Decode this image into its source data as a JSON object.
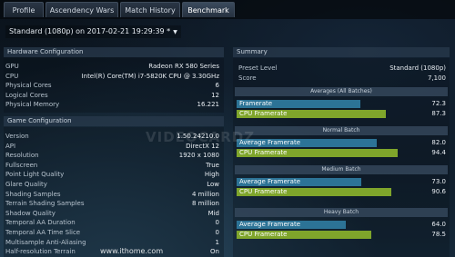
{
  "tabs": [
    {
      "label": "Profile"
    },
    {
      "label": "Ascendency Wars"
    },
    {
      "label": "Match History"
    },
    {
      "label": "Benchmark"
    }
  ],
  "run_selector": {
    "value": "Standard (1080p) on 2017-02-21 19:29:39 *"
  },
  "hardware": {
    "title": "Hardware Configuration",
    "rows": [
      {
        "label": "GPU",
        "value": "Radeon RX 580 Series"
      },
      {
        "label": "CPU",
        "value": "Intel(R) Core(TM) i7-5820K CPU @ 3.30GHz"
      },
      {
        "label": "Physical Cores",
        "value": "6"
      },
      {
        "label": "Logical Cores",
        "value": "12"
      },
      {
        "label": "Physical Memory",
        "value": "16.221"
      }
    ]
  },
  "game": {
    "title": "Game Configuration",
    "rows": [
      {
        "label": "Version",
        "value": "1.50.24210.0"
      },
      {
        "label": "API",
        "value": "DirectX 12"
      },
      {
        "label": "Resolution",
        "value": "1920 x 1080"
      },
      {
        "label": "Fullscreen",
        "value": "True"
      },
      {
        "label": "Point Light Quality",
        "value": "High"
      },
      {
        "label": "Glare Quality",
        "value": "Low"
      },
      {
        "label": "Shading Samples",
        "value": "4 million"
      },
      {
        "label": "Terrain Shading Samples",
        "value": "8 million"
      },
      {
        "label": "Shadow Quality",
        "value": "Mid"
      },
      {
        "label": "Temporal AA Duration",
        "value": "0"
      },
      {
        "label": "Temporal AA Time Slice",
        "value": "0"
      },
      {
        "label": "Multisample Anti-Aliasing",
        "value": "1"
      },
      {
        "label": "Half-resolution Terrain",
        "value": "On"
      }
    ]
  },
  "summary": {
    "title": "Summary",
    "preset_label": "Preset Level",
    "preset_value": "Standard (1080p)",
    "score_label": "Score",
    "score_value": "7,100",
    "batches": [
      {
        "name": "Averages (All Batches)",
        "fr_label": "Framerate",
        "fr_value": "72.3",
        "fr": 72.3,
        "cpu_label": "CPU Framerate",
        "cpu_value": "87.3",
        "cpu": 87.3
      },
      {
        "name": "Normal Batch",
        "fr_label": "Average Framerate",
        "fr_value": "82.0",
        "fr": 82.0,
        "cpu_label": "CPU Framerate",
        "cpu_value": "94.4",
        "cpu": 94.4
      },
      {
        "name": "Medium Batch",
        "fr_label": "Average Framerate",
        "fr_value": "73.0",
        "fr": 73.0,
        "cpu_label": "CPU Framerate",
        "cpu_value": "90.6",
        "cpu": 90.6
      },
      {
        "name": "Heavy Batch",
        "fr_label": "Average Framerate",
        "fr_value": "64.0",
        "fr": 64.0,
        "cpu_label": "CPU Framerate",
        "cpu_value": "78.5",
        "cpu": 78.5
      }
    ]
  },
  "watermarks": {
    "videocardz": "VIDEOCARDZ",
    "ithome": "www.ithome.com"
  },
  "colors": {
    "framerate": "#2c7396",
    "cpu": "#7fa52b",
    "header": "#34465a"
  }
}
